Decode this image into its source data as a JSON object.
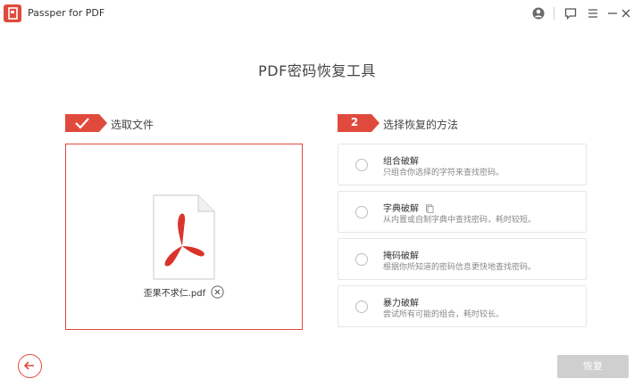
{
  "window": {
    "title": "Passper for PDF",
    "icons": [
      "account-icon",
      "feedback-icon",
      "menu-icon",
      "minimize-icon",
      "close-icon"
    ]
  },
  "page": {
    "title": "PDF密码恢复工具"
  },
  "step1": {
    "label": "选取文件",
    "status": "completed"
  },
  "step2": {
    "number": "2",
    "label": "选择恢复的方法"
  },
  "file": {
    "name": "歪果不求仁.pdf"
  },
  "methods": [
    {
      "title": "组合破解",
      "desc": "只组合你选择的字符来查找密码。"
    },
    {
      "title": "字典破解",
      "desc": "从内置或自制字典中查找密码，耗时较短。"
    },
    {
      "title": "掩码破解",
      "desc": "根据你所知道的密码信息更快地查找密码。"
    },
    {
      "title": "暴力破解",
      "desc": "尝试所有可能的组合，耗时较长。"
    }
  ],
  "footer": {
    "recover_label": "恢复"
  },
  "colors": {
    "accent": "#e04a3c",
    "disabled": "#cfcfcf"
  }
}
